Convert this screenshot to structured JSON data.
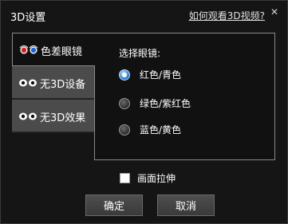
{
  "window": {
    "title": "3D设置",
    "help_link": "如何观看3D视频?",
    "close_glyph": "✕"
  },
  "tabs": [
    {
      "label": "色差眼镜",
      "icon": "anaglyph-glasses-icon",
      "active": true
    },
    {
      "label": "无3D设备",
      "icon": "eyes-icon",
      "active": false
    },
    {
      "label": "无3D效果",
      "icon": "eyes-icon",
      "active": false
    }
  ],
  "panel": {
    "label": "选择眼镜:",
    "options": [
      {
        "label": "红色/青色",
        "checked": true
      },
      {
        "label": "绿色/紫红色",
        "checked": false
      },
      {
        "label": "蓝色/黄色",
        "checked": false
      }
    ]
  },
  "stretch": {
    "label": "画面拉伸",
    "checked": false
  },
  "buttons": {
    "ok": "确定",
    "cancel": "取消"
  },
  "colors": {
    "accent": "#2f82d8",
    "background": "#151515",
    "tab_inactive": "#4b4b4b"
  }
}
